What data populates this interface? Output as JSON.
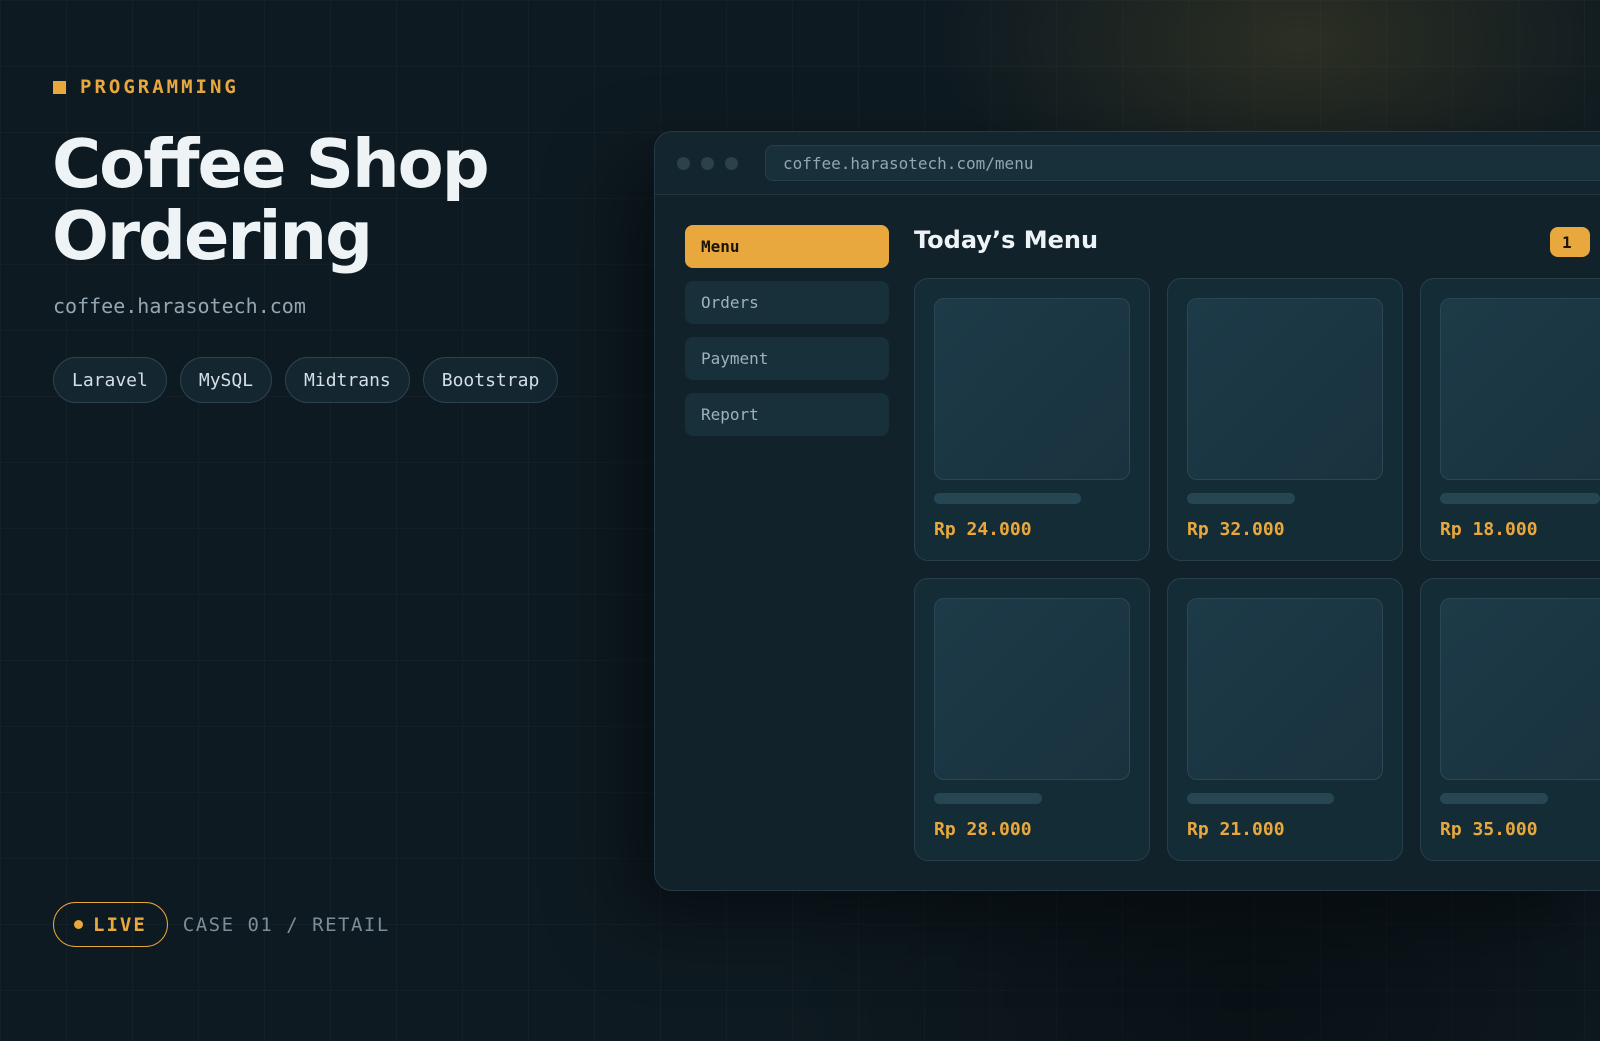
{
  "hero": {
    "eyebrow": "PROGRAMMING",
    "title": "Coffee Shop Ordering",
    "domain": "coffee.harasotech.com",
    "tags": [
      "Laravel",
      "MySQL",
      "Midtrans",
      "Bootstrap"
    ],
    "status": "LIVE",
    "case_label": "CASE 01 / RETAIL"
  },
  "browser": {
    "url": "coffee.harasotech.com/menu",
    "nav": [
      {
        "label": "Menu",
        "active": true
      },
      {
        "label": "Orders",
        "active": false
      },
      {
        "label": "Payment",
        "active": false
      },
      {
        "label": "Report",
        "active": false
      }
    ],
    "heading": "Today’s Menu",
    "badge": "1",
    "products": [
      {
        "price": "Rp 24.000"
      },
      {
        "price": "Rp 32.000"
      },
      {
        "price": "Rp 18.000"
      },
      {
        "price": "Rp 28.000"
      },
      {
        "price": "Rp 21.000"
      },
      {
        "price": "Rp 35.000"
      }
    ]
  },
  "colors": {
    "accent": "#e9a83d",
    "background": "#0e1a21",
    "panel": "#11222b"
  }
}
